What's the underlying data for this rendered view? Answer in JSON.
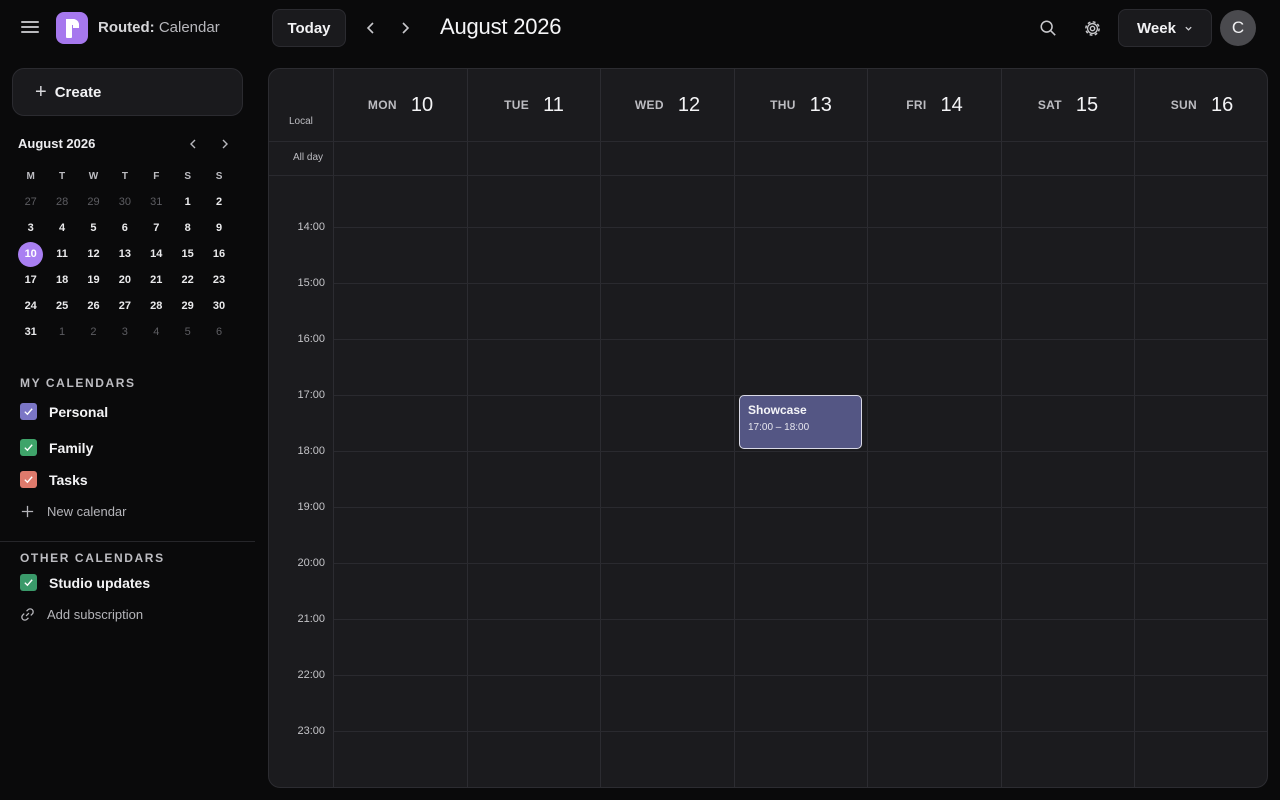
{
  "header": {
    "app_name": "Routed:",
    "app_section": "Calendar",
    "today_label": "Today",
    "month_title": "August 2026",
    "view_label": "Week",
    "avatar_initial": "C"
  },
  "sidebar": {
    "create_label": "Create",
    "mini_calendar": {
      "title": "August 2026",
      "weekdays": [
        "M",
        "T",
        "W",
        "T",
        "F",
        "S",
        "S"
      ],
      "weeks": [
        [
          "27",
          "28",
          "29",
          "30",
          "31",
          "1",
          "2"
        ],
        [
          "3",
          "4",
          "5",
          "6",
          "7",
          "8",
          "9"
        ],
        [
          "10",
          "11",
          "12",
          "13",
          "14",
          "15",
          "16"
        ],
        [
          "17",
          "18",
          "19",
          "20",
          "21",
          "22",
          "23"
        ],
        [
          "24",
          "25",
          "26",
          "27",
          "28",
          "29",
          "30"
        ],
        [
          "31",
          "1",
          "2",
          "3",
          "4",
          "5",
          "6"
        ]
      ],
      "selected": "10"
    },
    "my_calendars_label": "MY CALENDARS",
    "my_calendars": [
      {
        "label": "Personal",
        "color": "#7b76c6"
      },
      {
        "label": "Family",
        "color": "#3fa46a"
      },
      {
        "label": "Tasks",
        "color": "#df7a6c"
      }
    ],
    "new_calendar_label": "New calendar",
    "other_calendars_label": "OTHER CALENDARS",
    "other_calendars": [
      {
        "label": "Studio updates",
        "color": "#3a9a6a"
      }
    ],
    "add_subscription_label": "Add subscription"
  },
  "grid": {
    "timezone_label": "Local",
    "allday_label": "All day",
    "days": [
      {
        "dow": "MON",
        "dom": "10"
      },
      {
        "dow": "TUE",
        "dom": "11"
      },
      {
        "dow": "WED",
        "dom": "12"
      },
      {
        "dow": "THU",
        "dom": "13"
      },
      {
        "dow": "FRI",
        "dom": "14"
      },
      {
        "dow": "SAT",
        "dom": "15"
      },
      {
        "dow": "SUN",
        "dom": "16"
      }
    ],
    "hours": [
      "14:00",
      "15:00",
      "16:00",
      "17:00",
      "18:00",
      "19:00",
      "20:00",
      "21:00",
      "22:00",
      "23:00"
    ]
  },
  "events": [
    {
      "title": "Showcase",
      "time": "17:00 – 18:00",
      "color": "#545684"
    }
  ]
}
